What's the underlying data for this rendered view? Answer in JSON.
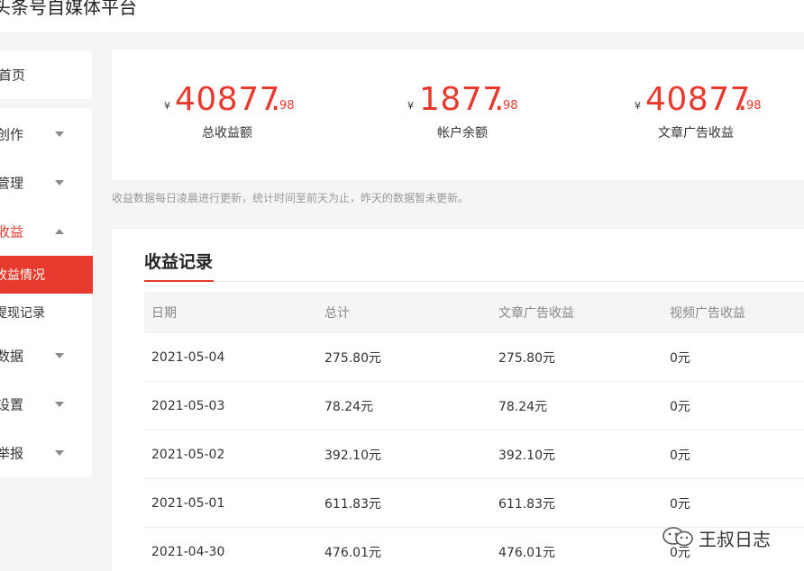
{
  "app": {
    "title": "头条号自媒体平台"
  },
  "sidebar": {
    "home_label": "首页",
    "items": [
      {
        "label": "创作",
        "caret": "down"
      },
      {
        "label": "管理",
        "caret": "down"
      },
      {
        "label": "收益",
        "caret": "up"
      },
      {
        "label": "收益情况"
      },
      {
        "label": "提现记录"
      },
      {
        "label": "数据",
        "caret": "down"
      },
      {
        "label": "设置",
        "caret": "down"
      },
      {
        "label": "举报",
        "caret": "down"
      }
    ]
  },
  "summary": {
    "currency": "¥",
    "stats": [
      {
        "integer": "40877",
        "decimal": "98",
        "caption": "总收益额"
      },
      {
        "integer": "1877",
        "decimal": "98",
        "caption": "帐户余额"
      },
      {
        "integer": "40877",
        "decimal": "98",
        "caption": "文章广告收益"
      }
    ]
  },
  "notice": "收益数据每日凌晨进行更新，统计时间至前天为止，昨天的数据暂未更新。",
  "records": {
    "tab_label": "收益记录",
    "columns": [
      "日期",
      "总计",
      "文章广告收益",
      "视频广告收益"
    ],
    "rows": [
      [
        "2021-05-04",
        "275.80元",
        "275.80元",
        "0元"
      ],
      [
        "2021-05-03",
        "78.24元",
        "78.24元",
        "0元"
      ],
      [
        "2021-05-02",
        "392.10元",
        "392.10元",
        "0元"
      ],
      [
        "2021-05-01",
        "611.83元",
        "611.83元",
        "0元"
      ],
      [
        "2021-04-30",
        "476.01元",
        "476.01元",
        "0元"
      ]
    ]
  },
  "watermark": {
    "text": "王叔日志",
    "icon": "wechat-icon"
  },
  "colors": {
    "accent": "#e83a2e",
    "page_bg": "#f4f5f6",
    "muted": "#999999"
  }
}
